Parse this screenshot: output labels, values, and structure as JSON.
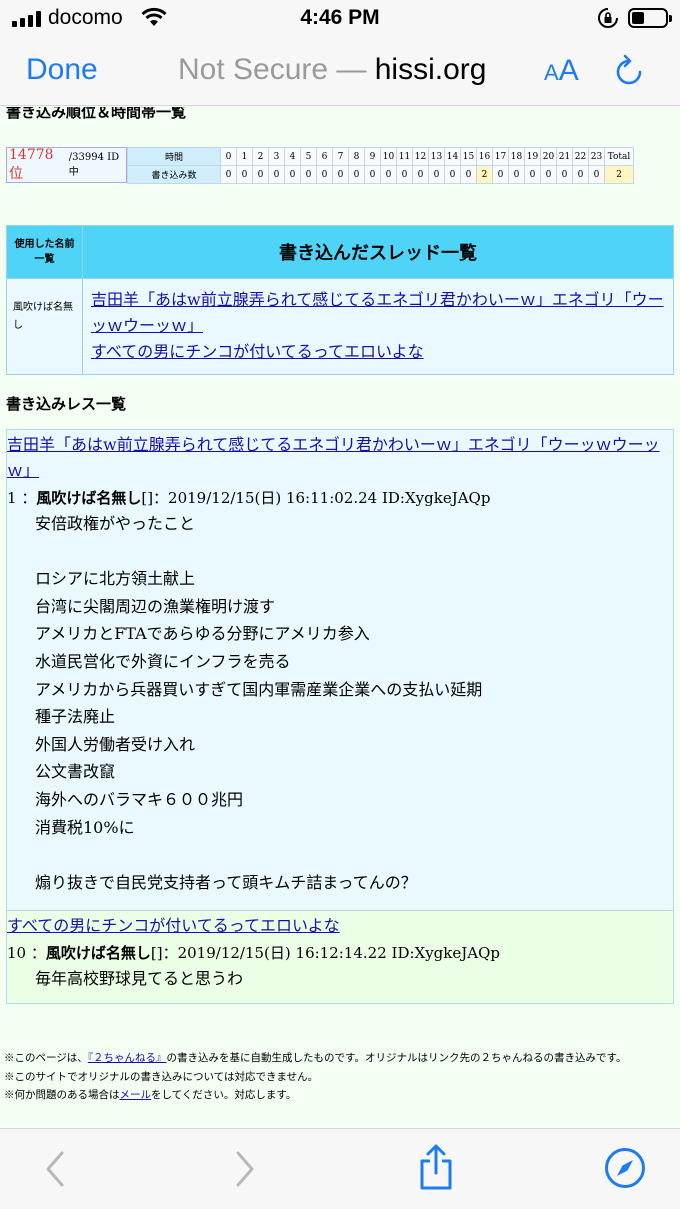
{
  "status": {
    "carrier": "docomo",
    "time": "4:46 PM"
  },
  "safari": {
    "done_label": "Done",
    "security": "Not Secure — ",
    "host": "hissi.org",
    "aa_small": "A",
    "aa_big": "A"
  },
  "page": {
    "section1_title": "書き込み順位＆時間帯一覧",
    "rank": {
      "rank_label": "14778 位",
      "total_label": "/33994 ID中"
    },
    "hours_table": {
      "time_label": "時間",
      "count_label": "書き込み数",
      "hours": [
        "0",
        "1",
        "2",
        "3",
        "4",
        "5",
        "6",
        "7",
        "8",
        "9",
        "10",
        "11",
        "12",
        "13",
        "14",
        "15",
        "16",
        "17",
        "18",
        "19",
        "20",
        "21",
        "22",
        "23",
        "Total"
      ],
      "counts": [
        "0",
        "0",
        "0",
        "0",
        "0",
        "0",
        "0",
        "0",
        "0",
        "0",
        "0",
        "0",
        "0",
        "0",
        "0",
        "0",
        "2",
        "0",
        "0",
        "0",
        "0",
        "0",
        "0",
        "0",
        "2"
      ]
    },
    "threads_table": {
      "name_header": "使用した名前一覧",
      "thread_header": "書き込んだスレッド一覧",
      "name_used": "風吹けば名無し",
      "threads": [
        "吉田羊「あはw前立腺弄られて感じてるエネゴリ君かわいーｗ」エネゴリ「ウーッｗウーッｗ」",
        "すべての男にチンコが付いてるってエロいよな"
      ]
    },
    "section2_title": "書き込みレス一覧",
    "posts": [
      {
        "thread_title": "吉田羊「あはw前立腺弄られて感じてるエネゴリ君かわいーｗ」エネゴリ「ウーッｗウーッｗ」",
        "number": "1",
        "name": "風吹けば名無し",
        "meta": "[]：2019/12/15(日) 16:11:02.24 ID:XygkeJAQp",
        "body": "安倍政権がやったこと\n\nロシアに北方領土献上\n台湾に尖閣周辺の漁業権明け渡す\nアメリカとFTAであらゆる分野にアメリカ参入\n水道民営化で外資にインフラを売る\nアメリカから兵器買いすぎて国内軍需産業企業への支払い延期\n種子法廃止\n外国人労働者受け入れ\n公文書改竄\n海外へのバラマキ６００兆円\n消費税10%に\n\n煽り抜きで自民党支持者って頭キムチ詰まってんの？"
      },
      {
        "thread_title": "すべての男にチンコが付いてるってエロいよな",
        "number": "10",
        "name": "風吹けば名無し",
        "meta": "[]：2019/12/15(日) 16:12:14.22 ID:XygkeJAQp",
        "body": "毎年高校野球見てると思うわ"
      }
    ],
    "footer": {
      "line1_pre": "※このページは、",
      "line1_link": "『２ちゃんねる』",
      "line1_post": "の書き込みを基に自動生成したものです。オリジナルはリンク先の２ちゃんねるの書き込みです。",
      "line2": "※このサイトでオリジナルの書き込みについては対応できません。",
      "line3_pre": "※何か問題のある場合は",
      "line3_link": "メール",
      "line3_post": "をしてください。対応します。"
    }
  },
  "colors": {
    "accent": "#1e7cf2",
    "link": "#1a0dab",
    "rank": "#dd3333",
    "table_header": "#4fd3f7"
  }
}
